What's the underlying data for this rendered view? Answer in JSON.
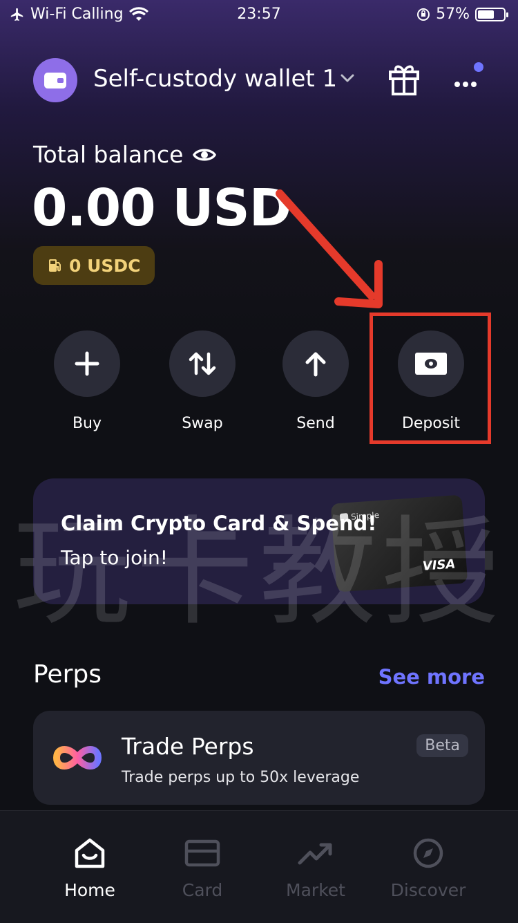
{
  "status_bar": {
    "carrier": "Wi-Fi Calling",
    "time": "23:57",
    "battery": "57%",
    "battery_level": 0.57
  },
  "header": {
    "wallet_name": "Self-custody wallet 1",
    "notification_dot_color": "#6f74ff"
  },
  "balance": {
    "label": "Total balance",
    "amount": "0.00 USD",
    "gas_badge": "0 USDC"
  },
  "actions": [
    {
      "label": "Buy",
      "icon": "plus-icon"
    },
    {
      "label": "Swap",
      "icon": "swap-icon"
    },
    {
      "label": "Send",
      "icon": "arrow-up-icon"
    },
    {
      "label": "Deposit",
      "icon": "cash-icon"
    }
  ],
  "annotation": {
    "highlight_color": "#e53a2b",
    "target": "Deposit"
  },
  "banner": {
    "title": "Claim Crypto Card & Spend!",
    "subtitle": "Tap to join!",
    "card_brand": "Simple",
    "card_network": "VISA"
  },
  "watermark": "玩卡教授",
  "perps": {
    "section_title": "Perps",
    "see_more": "See more",
    "card_title": "Trade Perps",
    "card_desc": "Trade perps up to 50x leverage",
    "badge": "Beta"
  },
  "bottom_nav": [
    {
      "label": "Home",
      "icon": "home-icon",
      "active": true
    },
    {
      "label": "Card",
      "icon": "card-icon",
      "active": false
    },
    {
      "label": "Market",
      "icon": "trending-icon",
      "active": false
    },
    {
      "label": "Discover",
      "icon": "compass-icon",
      "active": false
    }
  ],
  "colors": {
    "accent": "#6f74ff",
    "background": "#0f1015",
    "wallet_avatar": "#8e6ee8",
    "gas_badge_bg": "#4d3d12",
    "gas_badge_text": "#f2d27a"
  }
}
